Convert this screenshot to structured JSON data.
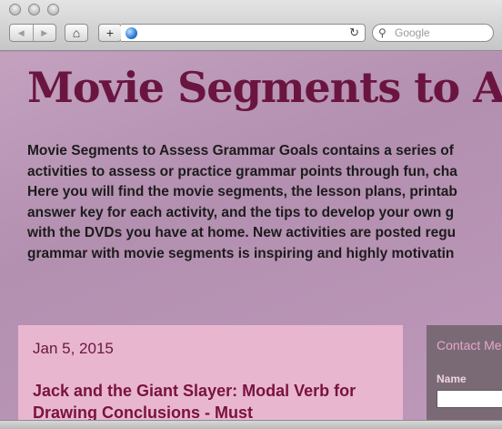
{
  "browser": {
    "back_icon": "◀",
    "forward_icon": "▶",
    "home_icon": "⌂",
    "add_icon": "+",
    "reload_icon": "↻",
    "search_icon": "⚲",
    "search_placeholder": "Google"
  },
  "blog": {
    "title": "Movie Segments to Assess Grammar Goals",
    "description_lines": [
      "Movie Segments to Assess Grammar Goals contains a series of",
      "activities to assess or practice grammar points through fun, cha",
      "Here you will find the movie segments, the lesson plans, printab",
      "answer key for each activity, and the tips to develop your own g",
      "with the DVDs you have at home. New activities are posted regu",
      "grammar with movie segments is inspiring and highly motivatin"
    ]
  },
  "post": {
    "date": "Jan 5, 2015",
    "title": "Jack and the Giant Slayer: Modal Verb for Drawing Conclusions - Must"
  },
  "sidebar": {
    "contact_title": "Contact Me",
    "name_label": "Name"
  },
  "colors": {
    "title": "#6a1540",
    "post_card": "#e8b7cf",
    "sidebar": "#7a6a76"
  }
}
